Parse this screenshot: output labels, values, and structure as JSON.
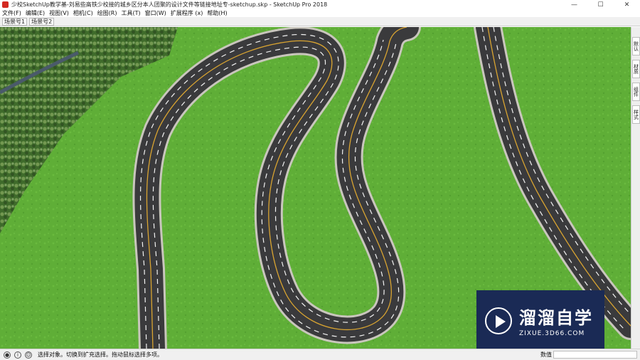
{
  "window": {
    "title": "少校SketchUp教学基-刘易些高铁少校接的城乡区分本人团聚的设计文件等链接地址专-sketchup.skp - SketchUp Pro 2018",
    "minimize_glyph": "—",
    "maximize_glyph": "☐",
    "close_glyph": "✕"
  },
  "menu": {
    "items": [
      "文件(F)",
      "编辑(E)",
      "视图(V)",
      "相机(C)",
      "绘图(R)",
      "工具(T)",
      "窗口(W)",
      "扩展程序 (x)",
      "帮助(H)"
    ]
  },
  "scenes": {
    "tabs": [
      "场景号1",
      "场景号2"
    ]
  },
  "tray": {
    "tabs": [
      "默认",
      "材质",
      "组件",
      "样式"
    ]
  },
  "status": {
    "message": "选择对象。切换到扩充选择。拖动鼠标选择多项。",
    "measure_label": "数值",
    "measure_value": ""
  },
  "watermark": {
    "brand": "溜溜自学",
    "url": "ZIXUE.3D66.COM"
  },
  "colors": {
    "grass": "#5fae37",
    "asphalt": "#3a3a3c",
    "lane_mark": "#f2f2f2",
    "center_line": "#d9a431",
    "watermark_bg": "#1a2a55"
  }
}
